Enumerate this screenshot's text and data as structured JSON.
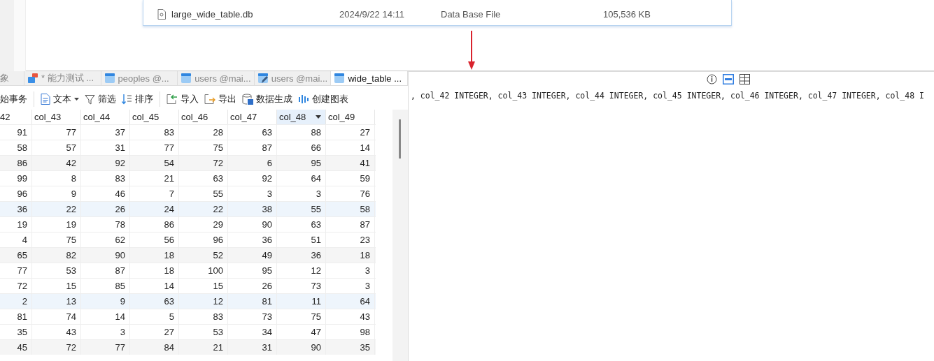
{
  "file_list": {
    "rows": [
      {
        "name": "large_wide_table.db",
        "modified": "2024/9/22 14:11",
        "type": "Data Base File",
        "size": "105,536 KB"
      }
    ]
  },
  "tabs": [
    {
      "label": "象",
      "kind": "plain",
      "selected": false
    },
    {
      "label": "* 能力测试 ...",
      "kind": "query",
      "selected": false
    },
    {
      "label": "peoples @...",
      "kind": "table",
      "selected": false
    },
    {
      "label": "users @mai...",
      "kind": "table",
      "selected": false
    },
    {
      "label": "users @mai...",
      "kind": "table-edit",
      "selected": false
    },
    {
      "label": "wide_table ...",
      "kind": "table",
      "selected": true
    }
  ],
  "toolbar": [
    [
      {
        "label": "始事务",
        "kind": "plain",
        "dropdown": false
      }
    ],
    [
      {
        "label": "文本",
        "kind": "text",
        "dropdown": true
      },
      {
        "label": "筛选",
        "kind": "filter",
        "dropdown": false
      },
      {
        "label": "排序",
        "kind": "sort",
        "dropdown": false
      }
    ],
    [
      {
        "label": "导入",
        "kind": "import",
        "dropdown": false
      },
      {
        "label": "导出",
        "kind": "export",
        "dropdown": false
      },
      {
        "label": "数据生成",
        "kind": "generate",
        "dropdown": false
      },
      {
        "label": "创建图表",
        "kind": "chart",
        "dropdown": false
      }
    ]
  ],
  "table": {
    "columns": [
      {
        "label": "42",
        "selected": false
      },
      {
        "label": "col_43",
        "selected": false
      },
      {
        "label": "col_44",
        "selected": false
      },
      {
        "label": "col_45",
        "selected": false
      },
      {
        "label": "col_46",
        "selected": false
      },
      {
        "label": "col_47",
        "selected": false
      },
      {
        "label": "col_48",
        "selected": true
      },
      {
        "label": "col_49",
        "selected": false
      }
    ],
    "rows": [
      {
        "kind": "plain",
        "cells": [
          "91",
          "77",
          "37",
          "83",
          "28",
          "63",
          "88",
          "27"
        ]
      },
      {
        "kind": "plain",
        "cells": [
          "58",
          "57",
          "31",
          "77",
          "75",
          "87",
          "66",
          "14"
        ]
      },
      {
        "kind": "striped",
        "cells": [
          "86",
          "42",
          "92",
          "54",
          "72",
          "6",
          "95",
          "41"
        ]
      },
      {
        "kind": "plain",
        "cells": [
          "99",
          "8",
          "83",
          "21",
          "63",
          "92",
          "64",
          "59"
        ]
      },
      {
        "kind": "plain",
        "cells": [
          "96",
          "9",
          "46",
          "7",
          "55",
          "3",
          "3",
          "76"
        ]
      },
      {
        "kind": "tinted",
        "cells": [
          "36",
          "22",
          "26",
          "24",
          "22",
          "38",
          "55",
          "58"
        ]
      },
      {
        "kind": "plain",
        "cells": [
          "19",
          "19",
          "78",
          "86",
          "29",
          "90",
          "63",
          "87"
        ]
      },
      {
        "kind": "plain",
        "cells": [
          "4",
          "75",
          "62",
          "56",
          "96",
          "36",
          "51",
          "23"
        ]
      },
      {
        "kind": "striped",
        "cells": [
          "65",
          "82",
          "90",
          "18",
          "52",
          "49",
          "36",
          "18"
        ]
      },
      {
        "kind": "plain",
        "cells": [
          "77",
          "53",
          "87",
          "18",
          "100",
          "95",
          "12",
          "3"
        ]
      },
      {
        "kind": "plain",
        "cells": [
          "72",
          "15",
          "85",
          "14",
          "15",
          "26",
          "73",
          "3"
        ]
      },
      {
        "kind": "tinted",
        "cells": [
          "2",
          "13",
          "9",
          "63",
          "12",
          "81",
          "11",
          "64"
        ]
      },
      {
        "kind": "plain",
        "cells": [
          "81",
          "74",
          "14",
          "5",
          "83",
          "73",
          "75",
          "43"
        ]
      },
      {
        "kind": "plain",
        "cells": [
          "35",
          "43",
          "3",
          "27",
          "53",
          "34",
          "47",
          "98"
        ]
      },
      {
        "kind": "striped",
        "cells": [
          "45",
          "72",
          "77",
          "84",
          "21",
          "31",
          "90",
          "35"
        ]
      }
    ]
  },
  "ddl_panel": {
    "views": [
      {
        "kind": "info",
        "selected": false
      },
      {
        "kind": "ddl",
        "selected": true
      },
      {
        "kind": "grid",
        "selected": false
      }
    ],
    "text": ", col_42 INTEGER, col_43 INTEGER, col_44 INTEGER, col_45 INTEGER, col_46 INTEGER, col_47 INTEGER, col_48 I"
  }
}
